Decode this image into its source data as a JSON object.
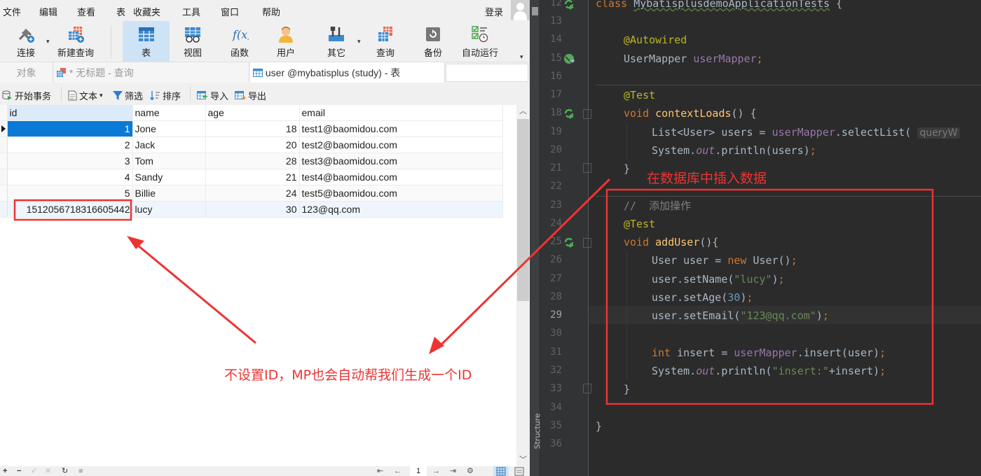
{
  "navicat": {
    "menu": [
      "文件",
      "编辑",
      "查看",
      "表",
      "收藏夹",
      "工具",
      "窗口",
      "帮助"
    ],
    "login": "登录",
    "toolbar": [
      {
        "label": "连接",
        "icon": "connection-plug-icon"
      },
      {
        "label": "新建查询",
        "icon": "new-query-icon"
      },
      {
        "label": "表",
        "icon": "table-icon",
        "active": true
      },
      {
        "label": "视图",
        "icon": "view-icon"
      },
      {
        "label": "函数",
        "icon": "function-icon"
      },
      {
        "label": "用户",
        "icon": "user-icon"
      },
      {
        "label": "其它",
        "icon": "tools-icon"
      },
      {
        "label": "查询",
        "icon": "query-icon"
      },
      {
        "label": "备份",
        "icon": "backup-icon"
      },
      {
        "label": "自动运行",
        "icon": "auto-run-icon"
      }
    ],
    "tabs": [
      {
        "label": "对象"
      },
      {
        "label": "* 无标题 - 查询"
      },
      {
        "label": "user @mybatisplus (study) - 表"
      }
    ],
    "subtoolbar": {
      "begin_transaction": "开始事务",
      "text": "文本",
      "filter": "筛选",
      "sort": "排序",
      "import": "导入",
      "export": "导出"
    },
    "grid": {
      "columns": [
        "id",
        "name",
        "age",
        "email"
      ],
      "rows": [
        {
          "id": "1",
          "name": "Jone",
          "age": "18",
          "email": "test1@baomidou.com"
        },
        {
          "id": "2",
          "name": "Jack",
          "age": "20",
          "email": "test2@baomidou.com"
        },
        {
          "id": "3",
          "name": "Tom",
          "age": "28",
          "email": "test3@baomidou.com"
        },
        {
          "id": "4",
          "name": "Sandy",
          "age": "21",
          "email": "test4@baomidou.com"
        },
        {
          "id": "5",
          "name": "Billie",
          "age": "24",
          "email": "test5@baomidou.com"
        },
        {
          "id": "1512056718316605442",
          "name": "lucy",
          "age": "30",
          "email": "123@qq.com"
        }
      ]
    },
    "statusbar": {
      "add": "+",
      "remove": "−",
      "apply": "✓",
      "discard": "✕",
      "refresh": "↻",
      "stop": "■",
      "first": "⇤",
      "prev": "←",
      "page": "1",
      "next": "→",
      "last": "⇥",
      "settings": "⚙"
    }
  },
  "ide": {
    "structure_label": "Structure",
    "line_numbers": [
      "12",
      "13",
      "14",
      "15",
      "16",
      "17",
      "18",
      "19",
      "20",
      "21",
      "22",
      "23",
      "24",
      "25",
      "26",
      "27",
      "28",
      "29",
      "30",
      "31",
      "32",
      "33",
      "34",
      "35",
      "36"
    ],
    "current_line": "29",
    "code": {
      "l12": {
        "kw": "class ",
        "name": "MybatisplusdemoApplicationTests",
        "rest": " {"
      },
      "l14": {
        "ann": "@Autowired"
      },
      "l15": {
        "type": "UserMapper ",
        "field": "userMapper",
        "semi": ";"
      },
      "l17": {
        "ann": "@Test"
      },
      "l18": {
        "kw": "void ",
        "fn": "contextLoads",
        "rest": "() {"
      },
      "l19": {
        "pre": "List<User> users = ",
        "field": "userMapper",
        "call": ".selectList(",
        "hint": "queryW"
      },
      "l20": {
        "pre": "System.",
        "out": "out",
        "call": ".println(users)",
        "semi": ";"
      },
      "l21": {
        "brace": "}"
      },
      "l23": {
        "cmt": "//  添加操作"
      },
      "l24": {
        "ann": "@Test"
      },
      "l25": {
        "kw": "void ",
        "fn": "addUser",
        "rest": "(){"
      },
      "l26": {
        "pre": "User user = ",
        "kw": "new ",
        "rest": "User()",
        "semi": ";"
      },
      "l27": {
        "pre": "user.setName(",
        "str": "\"lucy\"",
        "rest": ")",
        "semi": ";"
      },
      "l28": {
        "pre": "user.setAge(",
        "num": "30",
        "rest": ")",
        "semi": ";"
      },
      "l29": {
        "pre": "user.setEmail(",
        "str": "\"123@qq.com\"",
        "rest": ")",
        "semi": ";"
      },
      "l31": {
        "kw": "int ",
        "pre": "insert = ",
        "field": "userMapper",
        "rest": ".insert(user)",
        "semi": ";"
      },
      "l32": {
        "pre": "System.",
        "out": "out",
        "call": ".println(",
        "str": "\"insert:\"",
        "rest": "+insert)",
        "semi": ";"
      },
      "l33": {
        "brace": "}"
      },
      "l35": {
        "brace": "}"
      }
    }
  },
  "annotations": {
    "insert_label": "在数据库中插入数据",
    "autoid_label": "不设置ID，MP也会自动帮我们生成一个ID",
    "color": "#ee3333"
  }
}
